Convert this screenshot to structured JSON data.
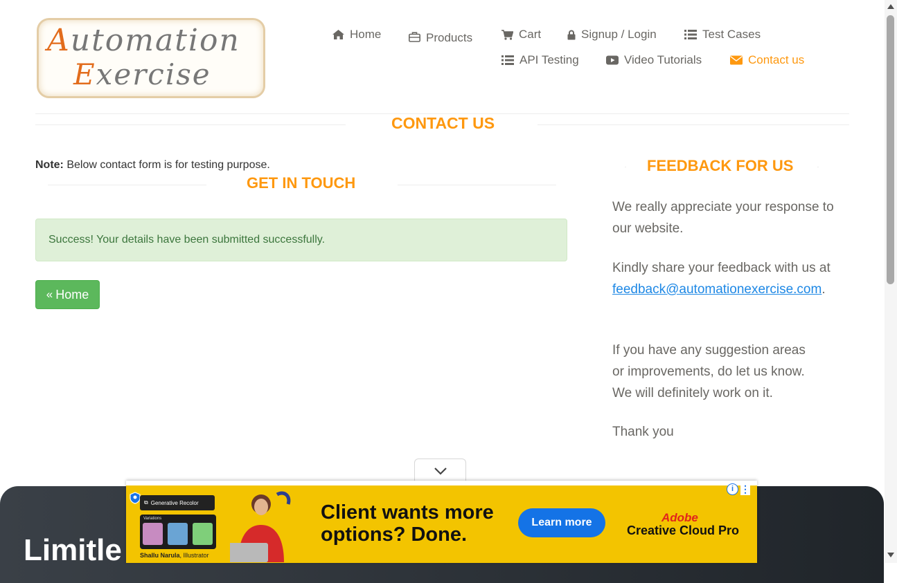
{
  "logo": {
    "line1_cap": "A",
    "line1_rest": "utomation",
    "line2_cap": "E",
    "line2_rest": "xercise"
  },
  "nav": {
    "home": "Home",
    "products": "Products",
    "cart": "Cart",
    "signup": "Signup / Login",
    "testcases": "Test Cases",
    "api": "API Testing",
    "videos": "Video Tutorials",
    "contact": "Contact us"
  },
  "main": {
    "title": "CONTACT US",
    "note_label": "Note:",
    "note_text": " Below contact form is for testing purpose.",
    "get_in_touch": "GET IN TOUCH",
    "success_message": "Success! Your details have been submitted successfully.",
    "home_button": "Home"
  },
  "feedback": {
    "title": "FEEDBACK FOR US",
    "p1": "We really appreciate your response to our website.",
    "p2_prefix": "Kindly share your feedback with us at",
    "email": "feedback@automationexercise.com",
    "p2_suffix": ".",
    "p3": "If you have any suggestion areas or improvements, do let us know. We will definitely work on it.",
    "p4": "Thank you"
  },
  "footer_banner": {
    "text": "Limitle"
  },
  "ad": {
    "headline_line1": "Client wants more",
    "headline_line2": "options? Done.",
    "cta": "Learn more",
    "brand_line1": "Adobe",
    "brand_line2": "Creative Cloud Pro",
    "feature_label": "Generative Recolor",
    "panel_label": "Variations",
    "caption_name": "Shallu Narula",
    "caption_role": ", Illustrator",
    "info": "i",
    "menu": "⋮"
  },
  "colors": {
    "accent": "#FE980F",
    "nav_text": "#696763",
    "success_bg": "#dff0d8",
    "success_text": "#3c763d",
    "button_green": "#5cb85c",
    "link": "#1e88e5",
    "ad_yellow": "#f3c400"
  }
}
